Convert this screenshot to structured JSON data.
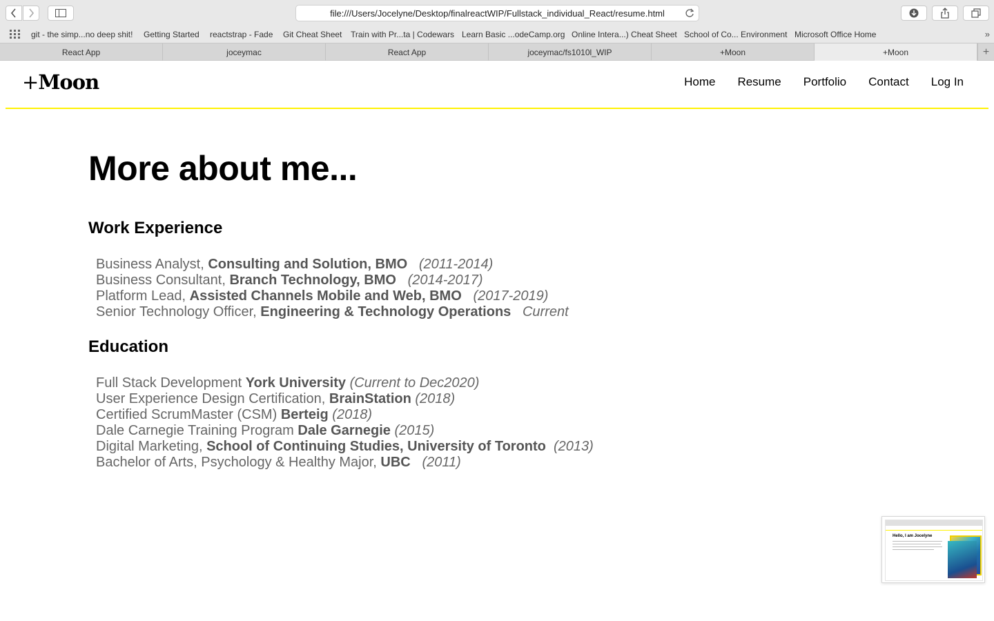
{
  "browser": {
    "url": "file:///Users/Jocelyne/Desktop/finalreactWIP/Fullstack_individual_React/resume.html",
    "bookmarks": [
      "git - the simp...no deep shit!",
      "Getting Started",
      "reactstrap - Fade",
      "Git Cheat Sheet",
      "Train with Pr...ta | Codewars",
      "Learn Basic ...odeCamp.org",
      "Online Intera...) Cheat Sheet",
      "School of Co... Environment",
      "Microsoft Office Home"
    ],
    "tabs": [
      "React App",
      "joceymac",
      "React App",
      "joceymac/fs1010l_WIP",
      "+Moon",
      "+Moon"
    ],
    "active_tab_index": 5,
    "icons": {
      "back": "chevron-left-icon",
      "forward": "chevron-right-icon",
      "sidebar": "sidebar-icon",
      "reload": "reload-icon",
      "download": "download-icon",
      "share": "share-icon",
      "tabs_overview": "tabs-overview-icon",
      "apps": "apps-grid-icon",
      "more_bookmarks": "double-chevron-icon",
      "new_tab": "plus-icon"
    }
  },
  "site": {
    "logo_plus": "+",
    "logo_text": "Moon",
    "nav": [
      "Home",
      "Resume",
      "Portfolio",
      "Contact",
      "Log In"
    ],
    "accent_color": "#fff200"
  },
  "page": {
    "heading": "More about me...",
    "work_heading": "Work Experience",
    "work": [
      {
        "role": "Business Analyst, ",
        "org": "Consulting and Solution, BMO",
        "period": "(2011-2014)"
      },
      {
        "role": "Business Consultant, ",
        "org": "Branch Technology, BMO",
        "period": "(2014-2017)"
      },
      {
        "role": "Platform Lead, ",
        "org": "Assisted Channels Mobile and Web, BMO",
        "period": "(2017-2019)"
      },
      {
        "role": "Senior Technology Officer, ",
        "org": "Engineering & Technology Operations",
        "period": "Current"
      }
    ],
    "education_heading": "Education",
    "education": [
      {
        "program": "Full Stack Development ",
        "org": "York University",
        "period": "(Current to Dec2020)"
      },
      {
        "program": "User Experience Design Certification, ",
        "org": "BrainStation",
        "period": "(2018)"
      },
      {
        "program": "Certified ScrumMaster (CSM) ",
        "org": "Berteig",
        "period": "(2018)"
      },
      {
        "program": "Dale Carnegie Training Program ",
        "org": "Dale Garnegie",
        "period": "(2015)"
      },
      {
        "program": "Digital Marketing, ",
        "org": "School of Continuing Studies, University of Toronto",
        "period": "(2013)"
      },
      {
        "program": "Bachelor of Arts, Psychology & Healthy Major, ",
        "org": "UBC",
        "period": "(2011)"
      }
    ]
  },
  "thumbnail": {
    "title": "Hello, I am Jocelyne"
  }
}
